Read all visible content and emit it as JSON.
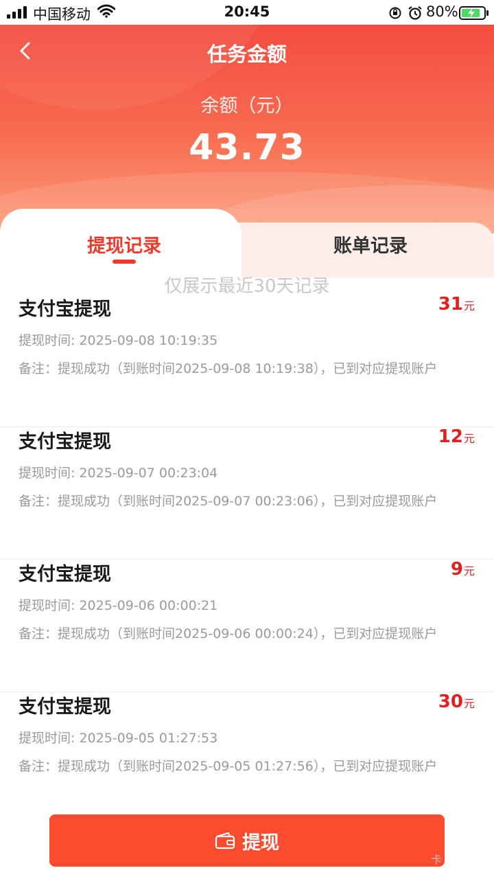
{
  "status_bar": {
    "carrier": "中国移动",
    "time": "20:45",
    "battery": "80%"
  },
  "header": {
    "title": "任务金额",
    "balance_label": "余额（元）",
    "balance_value": "43.73"
  },
  "tabs": [
    {
      "label": "提现记录",
      "active": true
    },
    {
      "label": "账单记录",
      "active": false
    }
  ],
  "hint": "仅展示最近30天记录",
  "records": [
    {
      "name": "支付宝提现",
      "amount": "31",
      "unit": "元",
      "time": "提现时间: 2025-09-08 10:19:35",
      "note": "备注：提现成功（到账时间2025-09-08 10:19:38），已到对应提现账户"
    },
    {
      "name": "支付宝提现",
      "amount": "12",
      "unit": "元",
      "time": "提现时间: 2025-09-07 00:23:04",
      "note": "备注：提现成功（到账时间2025-09-07 00:23:06），已到对应提现账户"
    },
    {
      "name": "支付宝提现",
      "amount": "9",
      "unit": "元",
      "time": "提现时间: 2025-09-06 00:00:21",
      "note": "备注：提现成功（到账时间2025-09-06 00:00:24），已到对应提现账户"
    },
    {
      "name": "支付宝提现",
      "amount": "30",
      "unit": "元",
      "time": "提现时间: 2025-09-05 01:27:53",
      "note": "备注：提现成功（到账时间2025-09-05 01:27:56），已到对应提现账户"
    }
  ],
  "withdraw_button": "提现",
  "watermark": "卡",
  "colors": {
    "accent": "#ef3b2e",
    "amount": "#e32020",
    "button": "#fc4b2e"
  }
}
